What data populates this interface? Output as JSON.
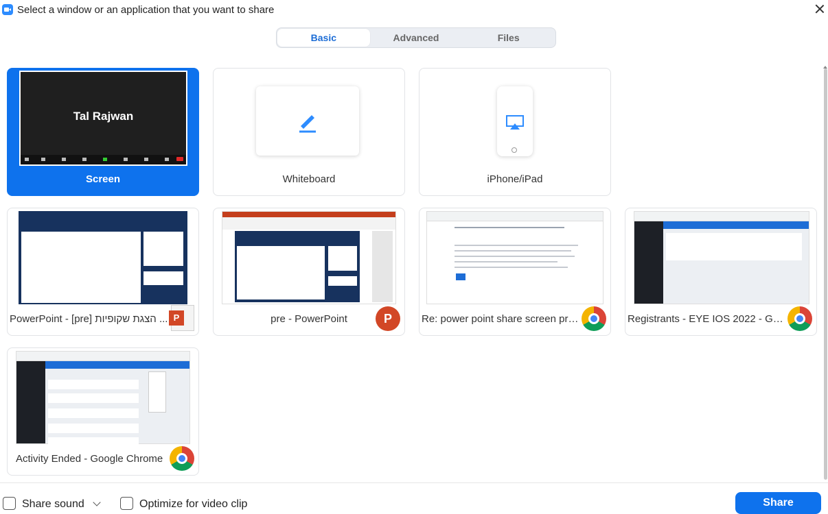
{
  "title": "Select a window or an application that you want to share",
  "tabs": [
    {
      "label": "Basic",
      "active": true
    },
    {
      "label": "Advanced",
      "active": false
    },
    {
      "label": "Files",
      "active": false
    }
  ],
  "tiles": {
    "screen": {
      "label": "Screen",
      "preview_name": "Tal Rajwan",
      "selected": true
    },
    "whiteboard": {
      "label": "Whiteboard"
    },
    "iphone": {
      "label": "iPhone/iPad"
    },
    "ppt_show": {
      "label": "PowerPoint - [pre] הצגת שקופיות ...",
      "app_icon": "powerpoint-icon"
    },
    "ppt_edit": {
      "label": "pre - PowerPoint",
      "app_icon": "powerpoint-icon"
    },
    "chrome_forum": {
      "label": "Re: power point share screen pro...",
      "app_icon": "chrome-icon"
    },
    "chrome_registrants": {
      "label": "Registrants - EYE IOS 2022 - Goo...",
      "app_icon": "chrome-icon"
    },
    "chrome_activity": {
      "label": "Activity Ended - Google Chrome",
      "app_icon": "chrome-icon"
    }
  },
  "footer": {
    "share_sound": "Share sound",
    "optimize_video": "Optimize for video clip",
    "share_button": "Share"
  },
  "colors": {
    "accent": "#0e72ed",
    "tab_active_text": "#1d6dd6"
  }
}
